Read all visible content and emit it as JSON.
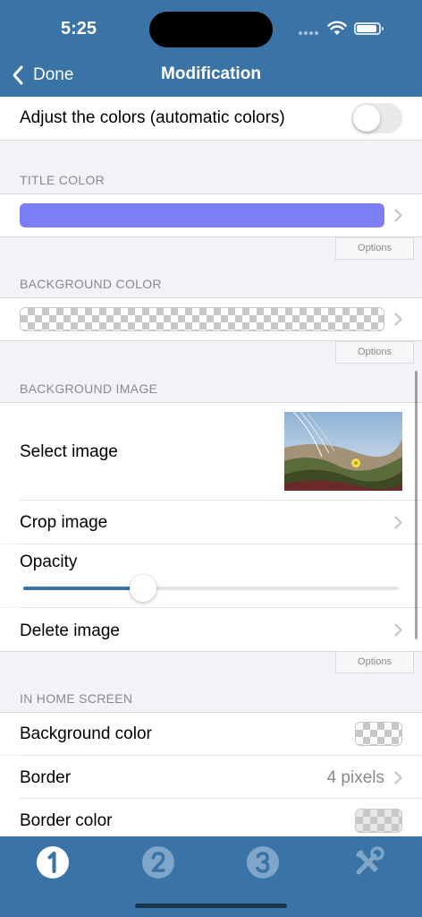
{
  "status": {
    "time": "5:25"
  },
  "nav": {
    "back_label": "Done",
    "title": "Modification"
  },
  "auto_colors": {
    "label": "Adjust the colors (automatic colors)",
    "enabled": false
  },
  "title_color": {
    "header": "TITLE COLOR",
    "color": "#7d7ef7",
    "options_label": "Options"
  },
  "background_color": {
    "header": "BACKGROUND COLOR",
    "color": "transparent",
    "options_label": "Options"
  },
  "background_image": {
    "header": "BACKGROUND IMAGE",
    "select_label": "Select image",
    "crop_label": "Crop image",
    "opacity_label": "Opacity",
    "opacity_value": 0.32,
    "delete_label": "Delete image",
    "options_label": "Options"
  },
  "home_screen": {
    "header": "IN HOME SCREEN",
    "background_color_label": "Background color",
    "border_label": "Border",
    "border_value": "4 pixels",
    "border_color_label": "Border color"
  },
  "tabs": [
    {
      "icon": "number-1-icon",
      "active": true
    },
    {
      "icon": "number-2-icon",
      "active": false
    },
    {
      "icon": "number-3-icon",
      "active": false
    },
    {
      "icon": "tools-icon",
      "active": false
    }
  ],
  "colors": {
    "accent": "#3a74a6",
    "title_swatch": "#7d7ef7"
  }
}
